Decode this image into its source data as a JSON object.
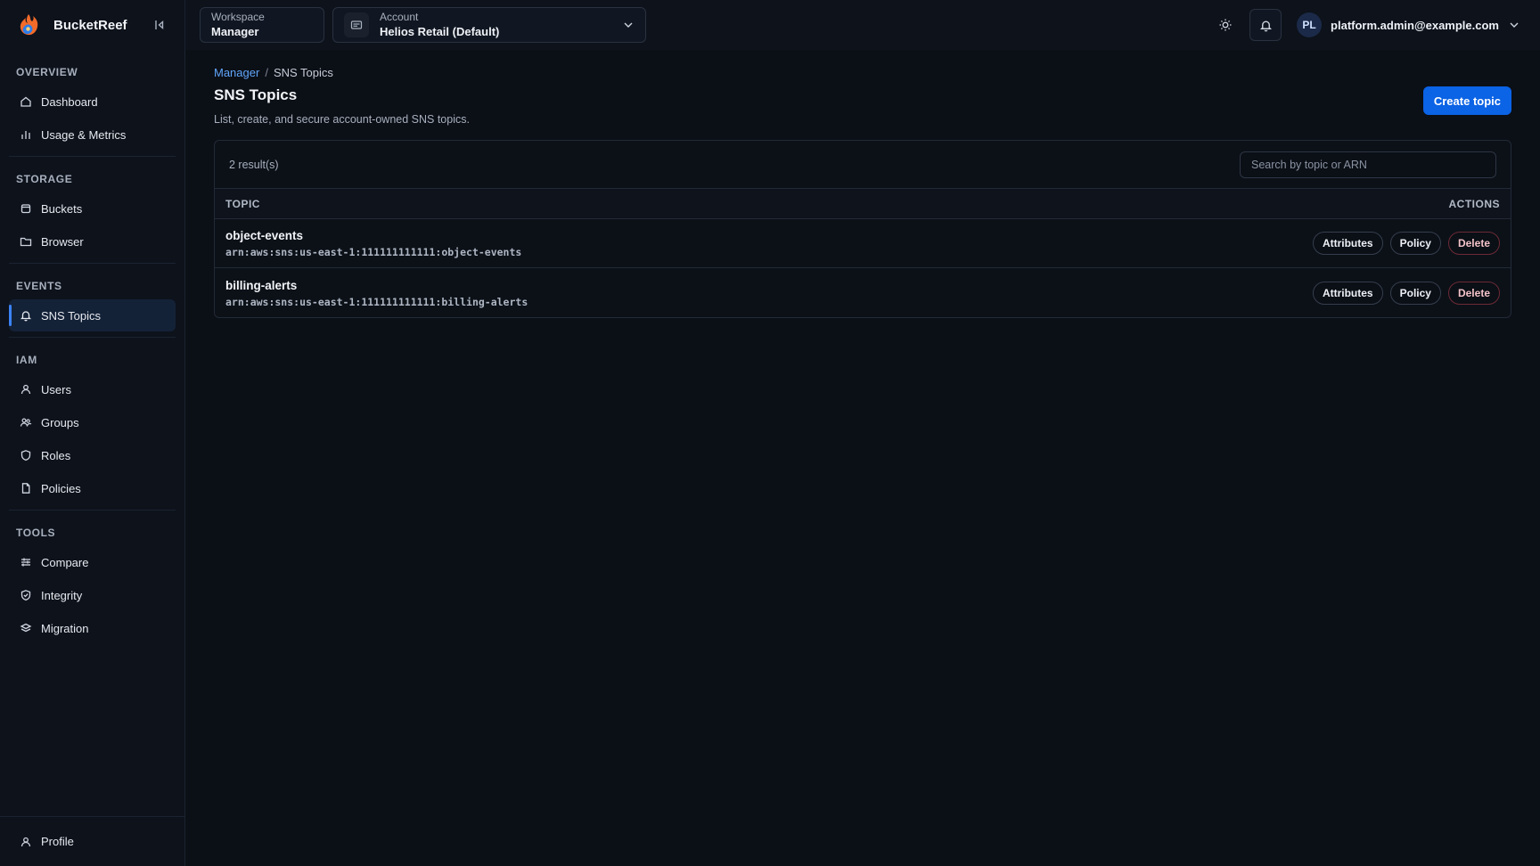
{
  "brand": {
    "name": "BucketReef"
  },
  "sidebar": {
    "sections": [
      {
        "title": "OVERVIEW",
        "items": [
          {
            "label": "Dashboard",
            "icon": "home-icon"
          },
          {
            "label": "Usage & Metrics",
            "icon": "bar-chart-icon"
          }
        ]
      },
      {
        "title": "STORAGE",
        "items": [
          {
            "label": "Buckets",
            "icon": "bucket-icon"
          },
          {
            "label": "Browser",
            "icon": "folder-icon"
          }
        ]
      },
      {
        "title": "EVENTS",
        "items": [
          {
            "label": "SNS Topics",
            "icon": "bell-icon",
            "active": true
          }
        ]
      },
      {
        "title": "IAM",
        "items": [
          {
            "label": "Users",
            "icon": "user-icon"
          },
          {
            "label": "Groups",
            "icon": "users-icon"
          },
          {
            "label": "Roles",
            "icon": "shield-icon"
          },
          {
            "label": "Policies",
            "icon": "file-icon"
          }
        ]
      },
      {
        "title": "TOOLS",
        "items": [
          {
            "label": "Compare",
            "icon": "sliders-icon"
          },
          {
            "label": "Integrity",
            "icon": "shield-check-icon"
          },
          {
            "label": "Migration",
            "icon": "migration-icon"
          }
        ]
      }
    ],
    "footer": {
      "label": "Profile",
      "icon": "user-icon"
    }
  },
  "topbar": {
    "workspace": {
      "label": "Workspace",
      "value": "Manager"
    },
    "account": {
      "label": "Account",
      "value": "Helios Retail (Default)"
    },
    "user": {
      "initials": "PL",
      "email": "platform.admin@example.com"
    }
  },
  "breadcrumb": {
    "parent": "Manager",
    "separator": "/",
    "current": "SNS Topics"
  },
  "page": {
    "title": "SNS Topics",
    "subtitle": "List, create, and secure account-owned SNS topics.",
    "create_button": "Create topic"
  },
  "table": {
    "result_count": "2 result(s)",
    "search_placeholder": "Search by topic or ARN",
    "columns": {
      "topic": "TOPIC",
      "actions": "ACTIONS"
    },
    "rows": [
      {
        "name": "object-events",
        "arn": "arn:aws:sns:us-east-1:111111111111:object-events"
      },
      {
        "name": "billing-alerts",
        "arn": "arn:aws:sns:us-east-1:111111111111:billing-alerts"
      }
    ],
    "actions": {
      "attributes": "Attributes",
      "policy": "Policy",
      "delete": "Delete"
    }
  },
  "colors": {
    "accent": "#0b63e5",
    "link": "#60a5fa",
    "danger_border": "#6b2a35",
    "active_nav": "#142238"
  }
}
